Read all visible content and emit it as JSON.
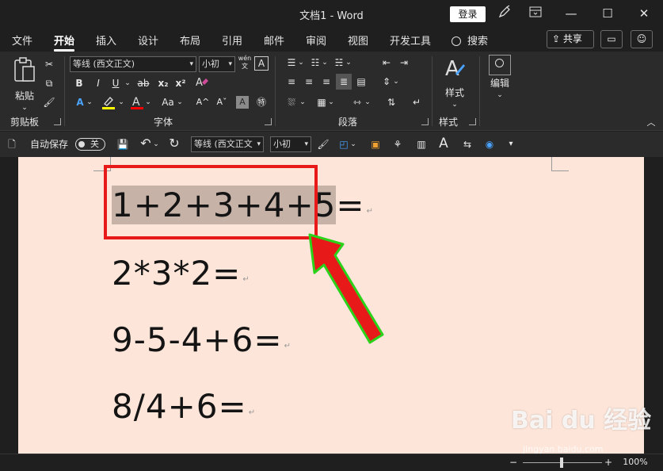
{
  "titlebar": {
    "title": "文档1  -  Word",
    "login": "登录",
    "minimize": "—",
    "maximize": "☐",
    "close": "✕"
  },
  "menu": {
    "tabs": [
      "文件",
      "开始",
      "插入",
      "设计",
      "布局",
      "引用",
      "邮件",
      "审阅",
      "视图",
      "开发工具"
    ],
    "active_index": 1,
    "search": "搜索",
    "share": "共享"
  },
  "ribbon": {
    "clipboard": {
      "paste": "粘贴",
      "group": "剪贴板"
    },
    "font": {
      "font_name": "等线 (西文正文)",
      "font_size": "小初",
      "wen": "wén",
      "bold": "B",
      "italic": "I",
      "underline": "U",
      "strike": "ab",
      "subscript": "x₂",
      "superscript": "x²",
      "aa": "Aa",
      "grow": "A^",
      "shrink": "Aˇ",
      "group": "字体"
    },
    "paragraph": {
      "group": "段落"
    },
    "styles": {
      "label": "样式",
      "group": "样式"
    },
    "editing": {
      "label": "编辑"
    }
  },
  "qat": {
    "autosave": "自动保存",
    "toggle_state": "关",
    "font_name": "等线 (西文正文",
    "font_size": "小初"
  },
  "document": {
    "lines": [
      "1+2+3+4+5=",
      "2*3*2=",
      "9-5-4+6=",
      "8/4+6="
    ],
    "selected_text": "1+2+3+4+5",
    "paragraph_mark": "↵"
  },
  "status": {
    "zoom_minus": "−",
    "zoom_plus": "+",
    "zoom": "100%"
  },
  "watermark": {
    "main": "Bai du 经验",
    "sub": "jingyan.baidu.com"
  },
  "colors": {
    "page": "#fde5d9",
    "selection": "#c7b2a7",
    "highlight_box": "#e81919",
    "arrow": "#e81919",
    "arrow_outline": "#2ad21a",
    "font_highlight": "#ffff00",
    "font_color": "#ff0000"
  }
}
